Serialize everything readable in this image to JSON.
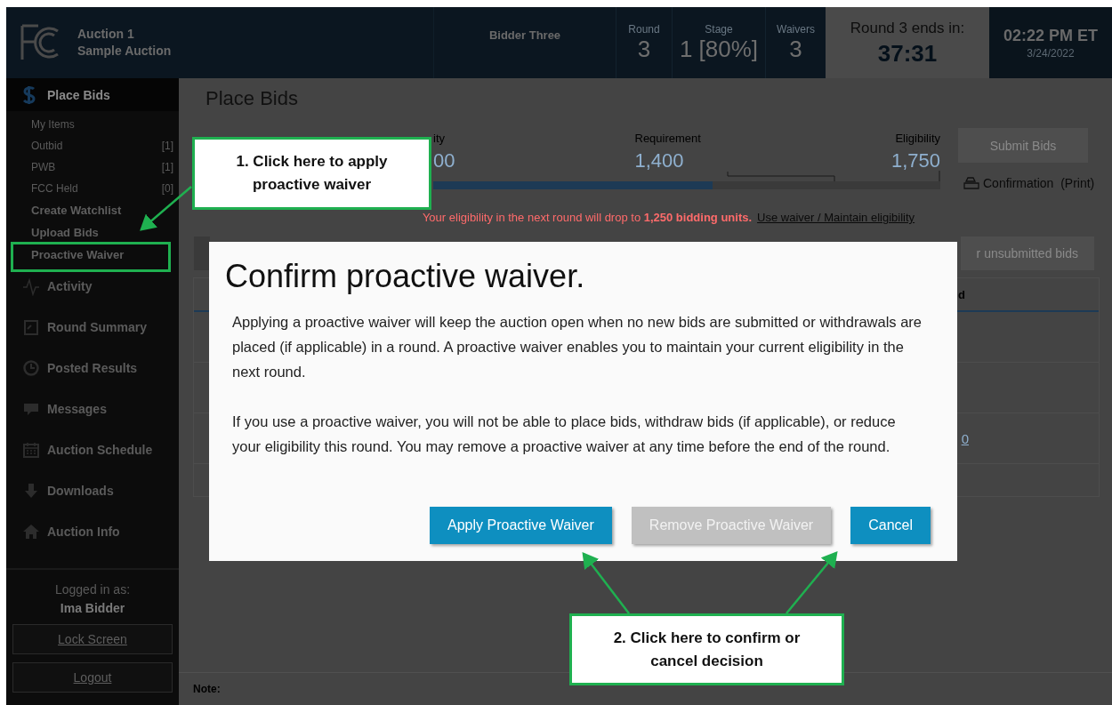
{
  "header": {
    "auction_name": "Auction 1",
    "auction_subtitle": "Sample Auction",
    "bidder": "Bidder Three",
    "stats": [
      {
        "label": "Round",
        "value": "3"
      },
      {
        "label": "Stage",
        "value": "1 [80%]"
      },
      {
        "label": "Waivers",
        "value": "3"
      }
    ],
    "timer": {
      "label": "Round 3 ends in:",
      "value": "37:31"
    },
    "clock": {
      "time": "02:22 PM ET",
      "date": "3/24/2022"
    }
  },
  "sidebar": {
    "items": [
      {
        "label": "Place Bids",
        "kind": "dollar",
        "selected": true,
        "children": [
          {
            "label": "My Items"
          },
          {
            "label": "Outbid",
            "count": "[1]"
          },
          {
            "label": "PWB",
            "count": "[1]"
          },
          {
            "label": "FCC Held",
            "count": "[0]"
          },
          {
            "label": "Create Watchlist",
            "kind": "action"
          },
          {
            "label": "Upload Bids",
            "kind": "action"
          },
          {
            "label": "Proactive Waiver",
            "kind": "action"
          }
        ]
      },
      {
        "label": "Activity",
        "kind": "pulse",
        "selected": false
      },
      {
        "label": "Round Summary",
        "kind": "report",
        "selected": false
      },
      {
        "label": "Posted Results",
        "kind": "clock",
        "selected": false
      },
      {
        "label": "Messages",
        "kind": "chat",
        "selected": false
      },
      {
        "label": "Auction Schedule",
        "kind": "calendar",
        "selected": false
      },
      {
        "label": "Downloads",
        "kind": "down",
        "selected": false
      },
      {
        "label": "Auction Info",
        "kind": "home",
        "selected": false
      }
    ],
    "logged_in_label": "Logged in as:",
    "user": "Ima Bidder",
    "buttons": [
      "Lock Screen",
      "Logout"
    ]
  },
  "main": {
    "title": "Place Bids",
    "stats": [
      {
        "label": "ity",
        "value": "00"
      },
      {
        "label": "Requirement",
        "value": "1,400"
      },
      {
        "label": "Eligibility",
        "value": "1,750"
      }
    ],
    "meter": {
      "level": 0.55
    },
    "submit_button": {
      "label": "Submit Bids",
      "disabled": true
    },
    "print_link": "Confirmation  (Print)",
    "warning": "Your eligibility in the next round will drop to **1,250 bidding units.**",
    "warning_link": "Use waiver / Maintain eligibility",
    "toolbar_button": "r unsubmitted bids",
    "table": {
      "header": "d",
      "rows": [
        {
          "kind": "blank"
        },
        {
          "kind": "blank"
        },
        {
          "kind": "link",
          "text": "0"
        },
        {
          "kind": "blank"
        }
      ]
    },
    "note": "Note:"
  },
  "modal": {
    "title": "Confirm proactive waiver.",
    "paragraphs": [
      "Applying a proactive waiver will keep the auction open when no new bids are submitted or withdrawals are placed (if applicable) in a round. A proactive waiver enables you to maintain your current eligibility in the next round.",
      "If you use a proactive waiver, you will not be able to place bids, withdraw bids (if applicable), or reduce your eligibility this round. You may remove a proactive waiver at any time before the end of the round."
    ],
    "buttons": [
      {
        "label": "Apply Proactive Waiver",
        "disabled": false
      },
      {
        "label": "Remove Proactive Waiver",
        "disabled": true
      },
      {
        "label": "Cancel",
        "disabled": false
      }
    ]
  },
  "annotations": [
    {
      "text": "1. Click here to apply proactive waiver"
    },
    {
      "text": "2. Click here to confirm or cancel decision"
    }
  ]
}
